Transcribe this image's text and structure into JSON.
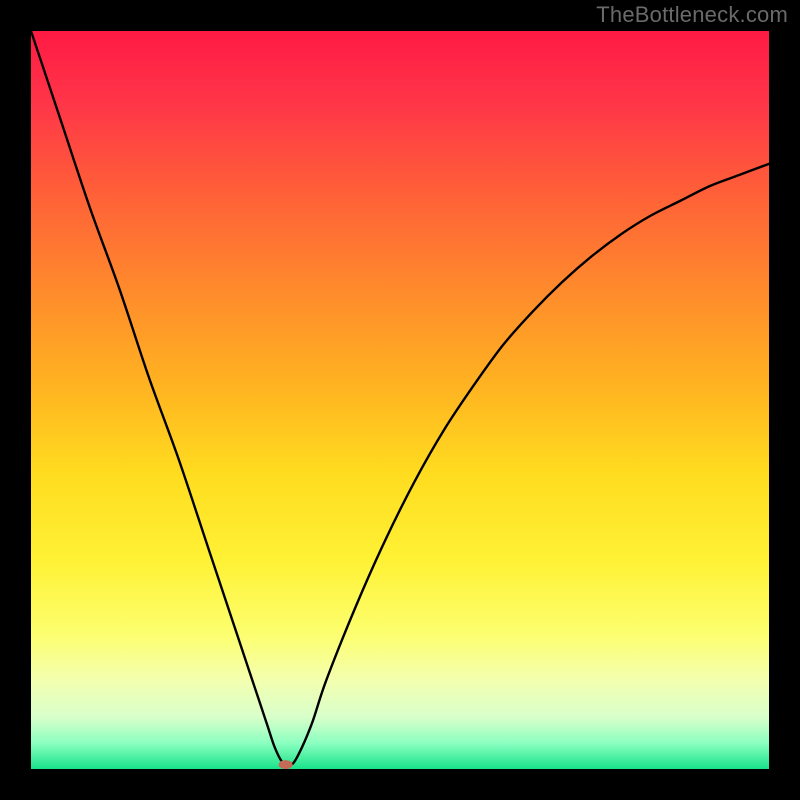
{
  "attribution": "TheBottleneck.com",
  "chart_data": {
    "type": "line",
    "title": "",
    "xlabel": "",
    "ylabel": "",
    "xlim": [
      0,
      100
    ],
    "ylim": [
      0,
      100
    ],
    "grid": false,
    "legend": false,
    "series": [
      {
        "name": "bottleneck-curve",
        "x": [
          0,
          4,
          8,
          12,
          16,
          20,
          24,
          28,
          30,
          32,
          33,
          34,
          35,
          36,
          38,
          40,
          44,
          48,
          52,
          56,
          60,
          64,
          68,
          72,
          76,
          80,
          84,
          88,
          92,
          96,
          100
        ],
        "y": [
          100,
          88,
          76,
          65,
          53,
          42,
          30,
          18,
          12,
          6,
          3,
          1,
          0.5,
          1.5,
          6,
          12,
          22,
          31,
          39,
          46,
          52,
          57.5,
          62,
          66,
          69.5,
          72.5,
          75,
          77,
          79,
          80.5,
          82
        ]
      }
    ],
    "marker": {
      "name": "optimal-point",
      "x": 34.5,
      "y": 0.6,
      "color": "#c36b57",
      "rx": 7,
      "ry": 4.5
    },
    "gradient_stops": [
      {
        "offset": 0.0,
        "color": "#ff1a44"
      },
      {
        "offset": 0.1,
        "color": "#ff3648"
      },
      {
        "offset": 0.22,
        "color": "#ff6038"
      },
      {
        "offset": 0.35,
        "color": "#ff8a2c"
      },
      {
        "offset": 0.48,
        "color": "#ffb321"
      },
      {
        "offset": 0.6,
        "color": "#ffdc1f"
      },
      {
        "offset": 0.72,
        "color": "#fff236"
      },
      {
        "offset": 0.82,
        "color": "#fcff71"
      },
      {
        "offset": 0.88,
        "color": "#f3ffb0"
      },
      {
        "offset": 0.93,
        "color": "#d8ffca"
      },
      {
        "offset": 0.965,
        "color": "#8bffc0"
      },
      {
        "offset": 1.0,
        "color": "#19e38a"
      }
    ]
  }
}
